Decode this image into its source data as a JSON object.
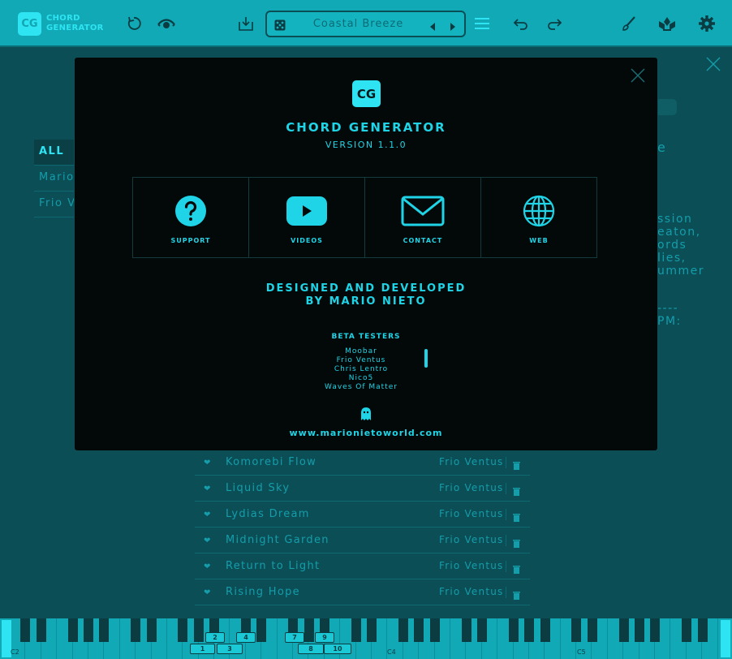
{
  "app": {
    "logo": "CG",
    "name_line1": "CHORD",
    "name_line2": "GENERATOR"
  },
  "toolbar": {
    "preset_name": "Coastal Breeze",
    "icons": [
      "reset-icon",
      "eye-icon",
      "save-icon",
      "dice-icon",
      "arrow-left-icon",
      "arrow-right-icon",
      "menu-icon",
      "undo-icon",
      "redo-icon",
      "brush-icon",
      "lotus-icon",
      "gear-icon"
    ]
  },
  "filters": [
    "ALL",
    "Mario",
    "Frio V"
  ],
  "side_fragments": {
    "title_partial": "e",
    "description_partial": "ssion\neaton,\nords\nlies,\nummer",
    "bpm_partial": "----\nPM:"
  },
  "presets": [
    {
      "name": "Komorebi Flow",
      "author": "Frio Ventus"
    },
    {
      "name": "Liquid Sky",
      "author": "Frio Ventus"
    },
    {
      "name": "Lydias Dream",
      "author": "Frio Ventus"
    },
    {
      "name": "Midnight Garden",
      "author": "Frio Ventus"
    },
    {
      "name": "Return to Light",
      "author": "Frio Ventus"
    },
    {
      "name": "Rising Hope",
      "author": "Frio Ventus"
    }
  ],
  "piano": {
    "octave_labels": [
      "C2",
      "C4",
      "C5"
    ],
    "chord_markers": [
      "1",
      "2",
      "3",
      "4",
      "7",
      "8",
      "9",
      "10"
    ]
  },
  "about": {
    "logo": "CG",
    "title": "CHORD GENERATOR",
    "version": "VERSION 1.1.0",
    "links": [
      {
        "label": "SUPPORT",
        "icon": "question-icon"
      },
      {
        "label": "VIDEOS",
        "icon": "play-icon"
      },
      {
        "label": "CONTACT",
        "icon": "mail-icon"
      },
      {
        "label": "WEB",
        "icon": "globe-icon"
      }
    ],
    "designed_line1": "DESIGNED AND DEVELOPED",
    "designed_line2": "BY MARIO NIETO",
    "beta_title": "BETA TESTERS",
    "beta_testers": [
      "Moobar",
      "Frio Ventus",
      "Chris Lentro",
      "Nico5",
      "Waves Of Matter"
    ],
    "website": "www.marionietoworld.com"
  },
  "colors": {
    "accent": "#1fd4e6",
    "toolbar": "#11a9b6",
    "modal_bg": "#030909",
    "app_bg": "#0b4e55"
  }
}
